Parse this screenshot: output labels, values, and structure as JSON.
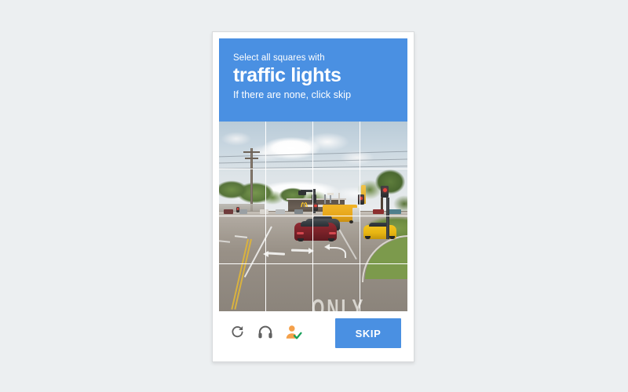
{
  "page": {
    "background_color": "#eceff1"
  },
  "captcha": {
    "widget_name": "reCAPTCHA image challenge",
    "header": {
      "background_color": "#4a90e2",
      "text_color": "#ffffff",
      "prompt_prefix": "Select all squares with",
      "prompt_target": "traffic lights",
      "prompt_hint": "If there are none, click skip"
    },
    "grid": {
      "rows": 4,
      "columns": 4,
      "total_tiles": 16,
      "selected_tiles": [],
      "scene_description": "Street-level photo of a road intersection with traffic lights, a McDonald's restaurant, a yellow box truck, a dark red sedan, a yellow sports car and painted road arrows.",
      "tiles": [
        {
          "index": 0,
          "row": 0,
          "col": 0,
          "content": "sky with clouds and power lines",
          "selected": false
        },
        {
          "index": 1,
          "row": 0,
          "col": 1,
          "content": "sky with large white cloud",
          "selected": false
        },
        {
          "index": 2,
          "row": 0,
          "col": 2,
          "content": "sky with cloud",
          "selected": false
        },
        {
          "index": 3,
          "row": 0,
          "col": 3,
          "content": "sky with tree foliage",
          "selected": false
        },
        {
          "index": 4,
          "row": 1,
          "col": 0,
          "content": "trees, utility pole and power lines",
          "selected": false
        },
        {
          "index": 5,
          "row": 1,
          "col": 1,
          "content": "clouds, trees and traffic signal mast",
          "selected": false
        },
        {
          "index": 6,
          "row": 1,
          "col": 2,
          "content": "McDonald's sign, building and traffic light",
          "selected": false
        },
        {
          "index": 7,
          "row": 1,
          "col": 3,
          "content": "traffic lights with red signals and pylon sign",
          "selected": false
        },
        {
          "index": 8,
          "row": 2,
          "col": 0,
          "content": "road with yellow centre line",
          "selected": false
        },
        {
          "index": 9,
          "row": 2,
          "col": 1,
          "content": "road with white turn arrows and red car",
          "selected": false
        },
        {
          "index": 10,
          "row": 2,
          "col": 2,
          "content": "red sedan, dark car and yellow truck",
          "selected": false
        },
        {
          "index": 11,
          "row": 2,
          "col": 3,
          "content": "yellow sports car, curb, grass and signal pole",
          "selected": false
        },
        {
          "index": 12,
          "row": 3,
          "col": 0,
          "content": "asphalt pavement with yellow line",
          "selected": false
        },
        {
          "index": 13,
          "row": 3,
          "col": 1,
          "content": "asphalt pavement",
          "selected": false
        },
        {
          "index": 14,
          "row": 3,
          "col": 2,
          "content": "pavement with ONLY road marking",
          "selected": false
        },
        {
          "index": 15,
          "row": 3,
          "col": 3,
          "content": "pavement with ONLY road marking",
          "selected": false
        }
      ],
      "scene_text": {
        "road_marking": "ONLY"
      }
    },
    "footer": {
      "reload_icon": "reload-icon",
      "reload_label": "Get a new challenge",
      "audio_icon": "headphones-icon",
      "audio_label": "Get an audio challenge",
      "help_icon": "person-check-icon",
      "help_label": "Get help",
      "skip_label": "SKIP",
      "skip_color": "#4a90e2"
    }
  }
}
